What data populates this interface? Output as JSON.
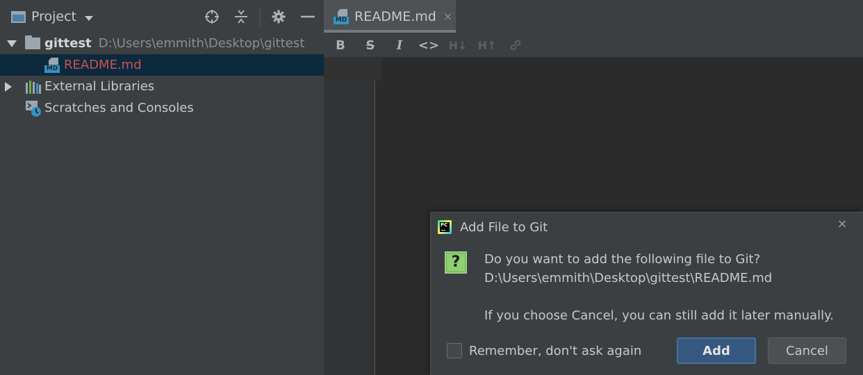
{
  "project_panel": {
    "title": "Project",
    "icons": [
      "crosshair-icon",
      "collapse-all-icon",
      "gear-icon",
      "minimize-icon"
    ],
    "tree": {
      "root_name": "gittest",
      "root_path": "D:\\Users\\emmith\\Desktop\\gittest",
      "readme_label": "README.md",
      "external_libraries_label": "External Libraries",
      "scratches_label": "Scratches and Consoles"
    }
  },
  "editor": {
    "tab_label": "README.md",
    "tab_close": "×",
    "toolbar": {
      "bold": "B",
      "strikethrough": "S",
      "italic": "I",
      "code": "<>",
      "header_down": "H↓",
      "header_up": "H↑",
      "link_icon": "link-icon"
    }
  },
  "dialog": {
    "title": "Add File to Git",
    "close": "×",
    "question_mark": "?",
    "message_line1": "Do you want to add the following file to Git?",
    "message_line2": "D:\\Users\\emmith\\Desktop\\gittest\\README.md",
    "message_line3": "If you choose Cancel, you can still add it later manually.",
    "remember_label": "Remember, don't ask again",
    "add_label": "Add",
    "cancel_label": "Cancel",
    "pc_logo": "PC"
  },
  "colors": {
    "selected_row": "#0d293e",
    "modified_file": "#c75450",
    "primary_button": "#365880"
  }
}
